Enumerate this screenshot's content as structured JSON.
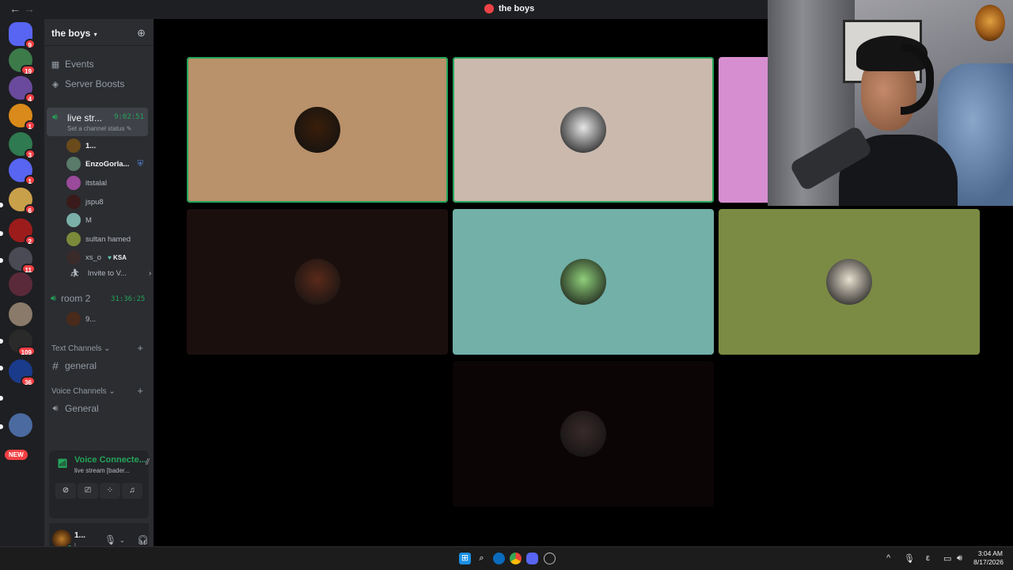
{
  "titlebar": {
    "back": "←",
    "forward": "→",
    "title": "the boys"
  },
  "servers": [
    {
      "badge": "9",
      "color": "#5865f2"
    },
    {
      "badge": "19",
      "color": "#3c7a4a"
    },
    {
      "badge": "4",
      "color": "#6a4a9c"
    },
    {
      "badge": "1",
      "color": "#d98a1a"
    },
    {
      "badge": "3",
      "color": "#2f7a50"
    },
    {
      "badge": "1",
      "color": "#5865f2"
    },
    {
      "badge": "6",
      "color": "#c9a04a"
    },
    {
      "badge": "2",
      "color": "#9c1c1c"
    },
    {
      "badge": "11",
      "color": "#4a4a55"
    },
    {
      "badge": "",
      "color": "#5a2a3a"
    },
    {
      "badge": "",
      "color": "#8a7a6a"
    },
    {
      "badge": "109",
      "color": "#2a2a2a"
    },
    {
      "badge": "36",
      "color": "#1a3a8a"
    },
    {
      "badge": "",
      "color": "#1e1f22"
    },
    {
      "badge": "",
      "color": "#4a6aa0"
    }
  ],
  "new_badge": "NEW",
  "sidebar": {
    "server_name": "the boys",
    "events": "Events",
    "boosts": "Server Boosts",
    "live_channel": {
      "name": "live str...",
      "time": "9:02:51",
      "status": "Set a channel status"
    },
    "members": [
      {
        "name": "1...",
        "color": "#6a4a1a",
        "me": true
      },
      {
        "name": "EnzoGorla...",
        "color": "#5a7a6a",
        "me": true
      },
      {
        "name": "itstalal",
        "color": "#9a4a9a",
        "me": false
      },
      {
        "name": "jspu8",
        "color": "#3a1a1a",
        "me": false
      },
      {
        "name": "M",
        "color": "#7ab0a8",
        "me": false
      },
      {
        "name": "sultan hamed",
        "color": "#7a8a3a",
        "me": false
      },
      {
        "name": "xs_o",
        "color": "#3a2a2a",
        "me": false
      }
    ],
    "ksa_tag": "KSA",
    "invite": "Invite to V...",
    "room2": {
      "name": "room 2",
      "time": "31:36:25",
      "member": "9..."
    },
    "text_channels": "Text Channels",
    "general_text": "general",
    "voice_channels": "Voice Channels",
    "general_voice": "General"
  },
  "voice_panel": {
    "status": "Voice Connecte...",
    "sub": "live stream [bader..."
  },
  "user_panel": {
    "name": "1...",
    "sub": "l..."
  },
  "tiles": [
    {
      "bg": "#b9916a",
      "pic": "#3a1e0a",
      "speaking": true
    },
    {
      "bg": "#cbb9ae",
      "pic": "#e6e6e6",
      "speaking": true
    },
    {
      "bg": "#d68ed0",
      "pic": "",
      "speaking": false
    },
    {
      "bg": "#1b0f0e",
      "pic": "#5a2a1a",
      "speaking": false
    },
    {
      "bg": "#72b0a8",
      "pic": "#8fcf7a",
      "speaking": false
    },
    {
      "bg": "#7b8b44",
      "pic": "#e8e0d0",
      "speaking": false
    },
    {
      "bg": "#0c0505",
      "pic": "#3a2a2a",
      "speaking": false
    }
  ],
  "taskbar": {
    "time": "3:04 AM",
    "date": "8/17/2026"
  }
}
